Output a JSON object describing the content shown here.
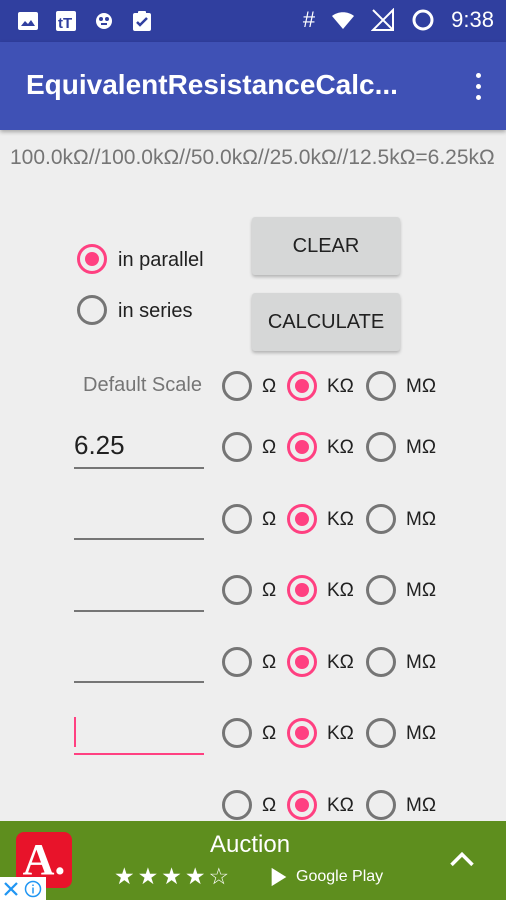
{
  "status": {
    "time": "9:38",
    "hash": "#"
  },
  "app": {
    "title": "EquivalentResistanceCalc..."
  },
  "result": {
    "text": "100.0kΩ//100.0kΩ//50.0kΩ//25.0kΩ//12.5kΩ=6.25kΩ"
  },
  "mode": {
    "parallel_label": "in parallel",
    "series_label": "in series",
    "selected": "in parallel"
  },
  "buttons": {
    "clear": "CLEAR",
    "calculate": "CALCULATE"
  },
  "default_scale": {
    "label": "Default Scale",
    "units": [
      "Ω",
      "KΩ",
      "MΩ"
    ],
    "selected": "KΩ"
  },
  "resistors": [
    {
      "value": "6.25",
      "selected": "KΩ"
    },
    {
      "value": "",
      "selected": "KΩ"
    },
    {
      "value": "",
      "selected": "KΩ"
    },
    {
      "value": "",
      "selected": "KΩ"
    },
    {
      "value": "",
      "selected": "KΩ",
      "focused": true
    },
    {
      "value": "",
      "selected": "KΩ"
    }
  ],
  "ad": {
    "title": "Auction",
    "logo_text": "A.",
    "stars": "★★★★☆",
    "store": "Google Play"
  },
  "colors": {
    "primary": "#3F51B5",
    "primary_dark": "#303F9F",
    "accent": "#FF4081",
    "ad_bg": "#5E8E1E"
  }
}
